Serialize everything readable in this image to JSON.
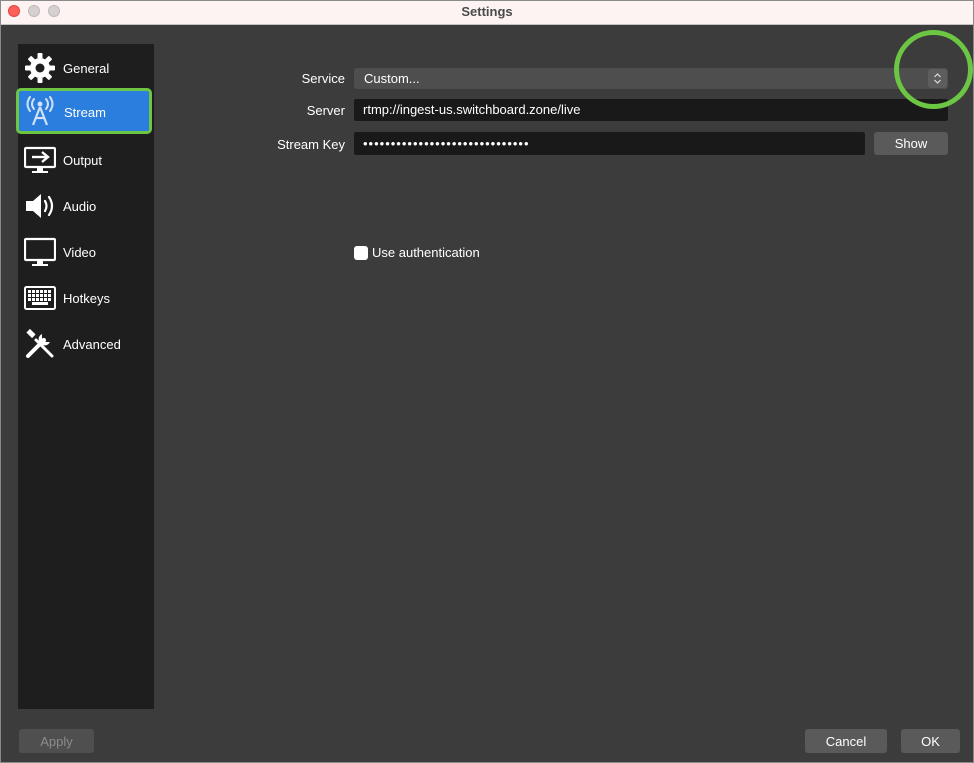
{
  "window": {
    "title": "Settings"
  },
  "sidebar": {
    "items": [
      {
        "label": "General",
        "icon": "gear-icon"
      },
      {
        "label": "Stream",
        "icon": "antenna-icon"
      },
      {
        "label": "Output",
        "icon": "monitor-output-icon"
      },
      {
        "label": "Audio",
        "icon": "speaker-icon"
      },
      {
        "label": "Video",
        "icon": "monitor-icon"
      },
      {
        "label": "Hotkeys",
        "icon": "keyboard-icon"
      },
      {
        "label": "Advanced",
        "icon": "tools-icon"
      }
    ],
    "active": "Stream"
  },
  "stream": {
    "service_label": "Service",
    "service_value": "Custom...",
    "server_label": "Server",
    "server_value": "rtmp://ingest-us.switchboard.zone/live",
    "key_label": "Stream Key",
    "key_value": "••••••••••••••••••••••••••••••",
    "show_label": "Show",
    "auth_label": "Use authentication",
    "auth_checked": false
  },
  "footer": {
    "apply_label": "Apply",
    "cancel_label": "Cancel",
    "ok_label": "OK"
  },
  "colors": {
    "accent": "#2b7ede",
    "highlight": "#6cc644",
    "background": "#3c3c3c",
    "sidebar": "#1e1e1e"
  }
}
